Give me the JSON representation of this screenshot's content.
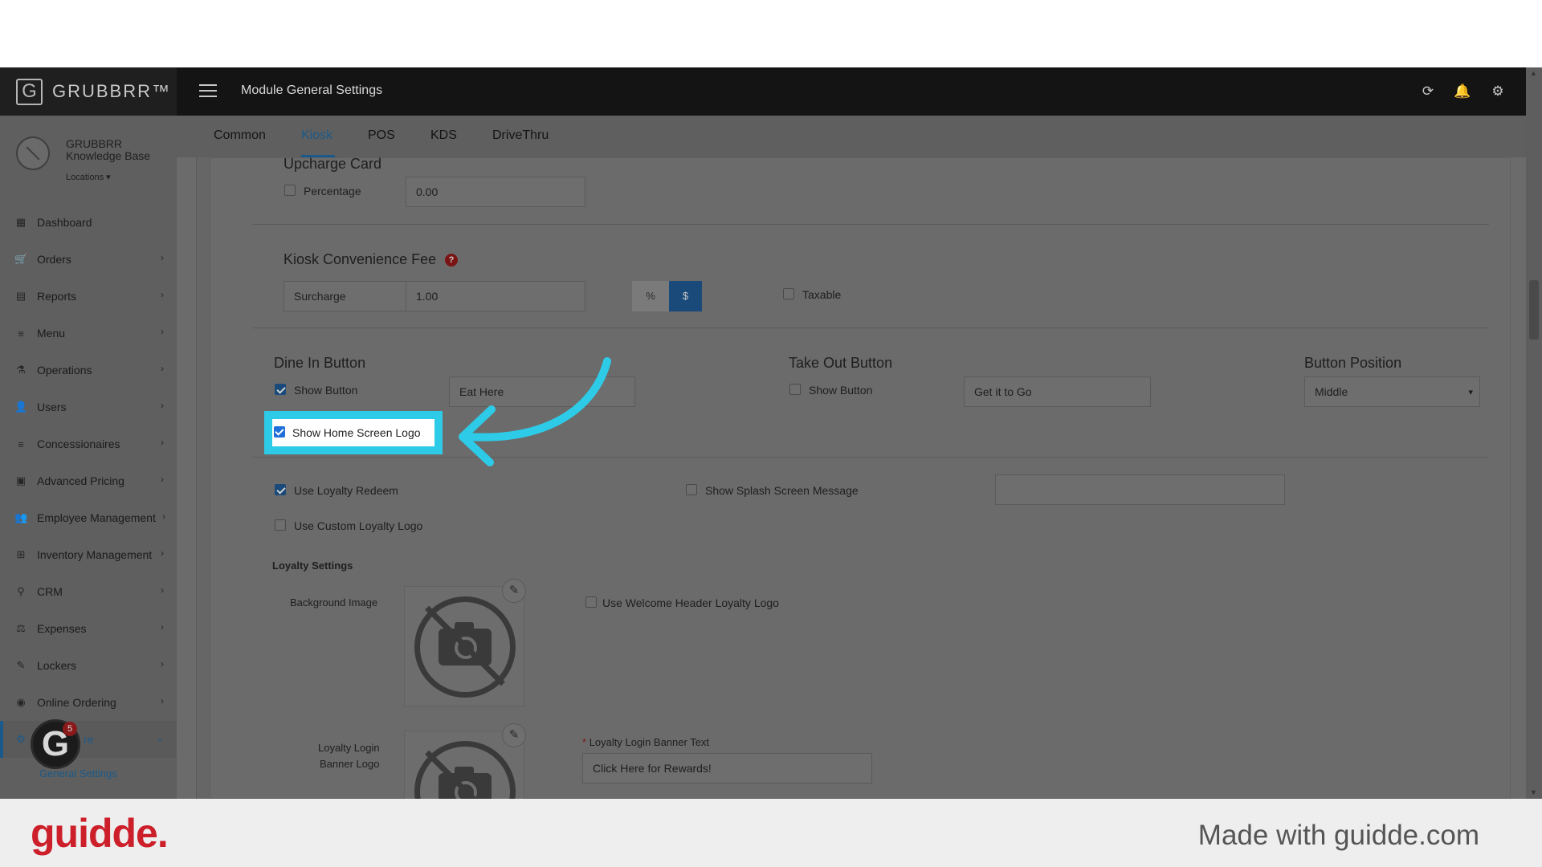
{
  "app": {
    "logo_letter": "G",
    "logo_text": "GRUBBRR™",
    "page_title": "Module General Settings"
  },
  "topbar_icons": [
    "refresh-icon",
    "bell-icon",
    "gear-icon"
  ],
  "profile": {
    "name": "GRUBBRR Knowledge Base",
    "locations_label": "Locations ▾"
  },
  "sidebar": {
    "items": [
      {
        "label": "Dashboard",
        "icon": "▦"
      },
      {
        "label": "Orders",
        "icon": "🛒"
      },
      {
        "label": "Reports",
        "icon": "▤"
      },
      {
        "label": "Menu",
        "icon": "≡"
      },
      {
        "label": "Operations",
        "icon": "⚗"
      },
      {
        "label": "Users",
        "icon": "👤"
      },
      {
        "label": "Concessionaires",
        "icon": "≡"
      },
      {
        "label": "Advanced Pricing",
        "icon": "▣"
      },
      {
        "label": "Employee Management",
        "icon": "👥"
      },
      {
        "label": "Inventory Management",
        "icon": "⊞"
      },
      {
        "label": "CRM",
        "icon": "⚲"
      },
      {
        "label": "Expenses",
        "icon": "⚖"
      },
      {
        "label": "Lockers",
        "icon": "✎"
      },
      {
        "label": "Online Ordering",
        "icon": "◉"
      },
      {
        "label": "re",
        "icon": "⚙"
      }
    ],
    "sub_item": "General Settings",
    "badge_letter": "G",
    "badge_count": "5"
  },
  "tabs": [
    "Common",
    "Kiosk",
    "POS",
    "KDS",
    "DriveThru"
  ],
  "upcharge": {
    "title": "Upcharge Card",
    "percentage_label": "Percentage",
    "value": "0.00"
  },
  "convenience_fee": {
    "title": "Kiosk Convenience Fee",
    "help": "?",
    "type_value": "Surcharge",
    "amount_value": "1.00",
    "pct_label": "%",
    "dollar_label": "$",
    "taxable_label": "Taxable"
  },
  "dine_in": {
    "title": "Dine In Button",
    "show_label": "Show Button",
    "text_value": "Eat Here",
    "home_logo_label": "Show Home Screen Logo"
  },
  "take_out": {
    "title": "Take Out Button",
    "show_label": "Show Button",
    "text_value": "Get it to Go"
  },
  "button_position": {
    "title": "Button Position",
    "value": "Middle"
  },
  "loyalty": {
    "use_redeem_label": "Use Loyalty Redeem",
    "custom_logo_label": "Use Custom Loyalty Logo",
    "splash_label": "Show Splash Screen Message",
    "splash_value": "",
    "settings_title": "Loyalty Settings",
    "background_label": "Background Image",
    "welcome_header_label": "Use Welcome Header Loyalty Logo",
    "banner_logo_label_1": "Loyalty Login",
    "banner_logo_label_2": "Banner Logo",
    "banner_text_required": "*",
    "banner_text_label": "Loyalty Login Banner Text",
    "banner_text_value": "Click Here for Rewards!"
  },
  "footer": {
    "brand": "guidde.",
    "tagline": "Made with guidde.com"
  },
  "colors": {
    "highlight": "#2ecbe8",
    "accent": "#1a5a8a",
    "brand_red": "#cc1f2a"
  }
}
